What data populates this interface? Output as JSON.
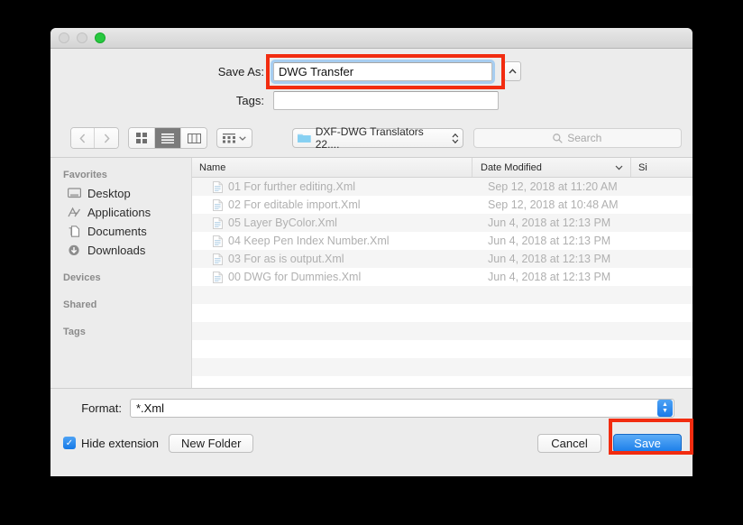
{
  "window": {
    "traffic_lights": [
      "close-disabled",
      "minimize-disabled",
      "zoom-green"
    ]
  },
  "header": {
    "save_as_label": "Save As:",
    "save_as_value": "DWG Transfer",
    "tags_label": "Tags:",
    "tags_value": "",
    "expand_icon": "chevron-up-icon"
  },
  "toolbar": {
    "back_icon": "chevron-left-icon",
    "forward_icon": "chevron-right-icon",
    "view_icon_label": "icon-view-icon",
    "view_list_label": "list-view-icon",
    "view_column_label": "column-view-icon",
    "selected_view": "list",
    "arrange_icon": "arrange-grid-icon",
    "arrange_chevron": "chevron-down-icon",
    "path_folder_icon": "folder-icon",
    "path_label": "DXF-DWG Translators 22....",
    "path_chevron": "up-down-chevron-icon",
    "search_icon": "search-icon",
    "search_placeholder": "Search",
    "search_value": ""
  },
  "sidebar": {
    "sections": [
      {
        "title": "Favorites",
        "items": [
          {
            "label": "Desktop",
            "icon": "desktop-icon"
          },
          {
            "label": "Applications",
            "icon": "applications-icon"
          },
          {
            "label": "Documents",
            "icon": "documents-icon"
          },
          {
            "label": "Downloads",
            "icon": "downloads-icon"
          }
        ]
      },
      {
        "title": "Devices",
        "items": []
      },
      {
        "title": "Shared",
        "items": []
      },
      {
        "title": "Tags",
        "items": []
      }
    ]
  },
  "filelist": {
    "columns": {
      "name": "Name",
      "date_modified": "Date Modified",
      "sort_chevron": "chevron-down-icon",
      "size": "Si"
    },
    "rows": [
      {
        "icon": "xml-document-icon",
        "name": "01 For further editing.Xml",
        "date": "Sep 12, 2018 at 11:20 AM",
        "size": ""
      },
      {
        "icon": "xml-document-icon",
        "name": "02 For editable import.Xml",
        "date": "Sep 12, 2018 at 10:48 AM",
        "size": ""
      },
      {
        "icon": "xml-document-icon",
        "name": "05 Layer ByColor.Xml",
        "date": "Jun 4, 2018 at 12:13 PM",
        "size": ""
      },
      {
        "icon": "xml-document-icon",
        "name": "04 Keep Pen Index Number.Xml",
        "date": "Jun 4, 2018 at 12:13 PM",
        "size": ""
      },
      {
        "icon": "xml-document-icon",
        "name": "03 For as is output.Xml",
        "date": "Jun 4, 2018 at 12:13 PM",
        "size": ""
      },
      {
        "icon": "xml-document-icon",
        "name": "00 DWG for Dummies.Xml",
        "date": "Jun 4, 2018 at 12:13 PM",
        "size": ""
      }
    ],
    "empty_row_count": 6
  },
  "footer": {
    "format_label": "Format:",
    "format_value": "*.Xml",
    "format_stepper_icon": "up-down-stepper-icon",
    "hide_extension_label": "Hide extension",
    "hide_extension_checked": true,
    "check_icon": "checkmark-icon",
    "new_folder_label": "New Folder",
    "cancel_label": "Cancel",
    "save_label": "Save"
  },
  "annotations": {
    "color": "#f22c10",
    "boxes": [
      {
        "target": "save-as-field"
      },
      {
        "target": "save-button"
      }
    ]
  }
}
